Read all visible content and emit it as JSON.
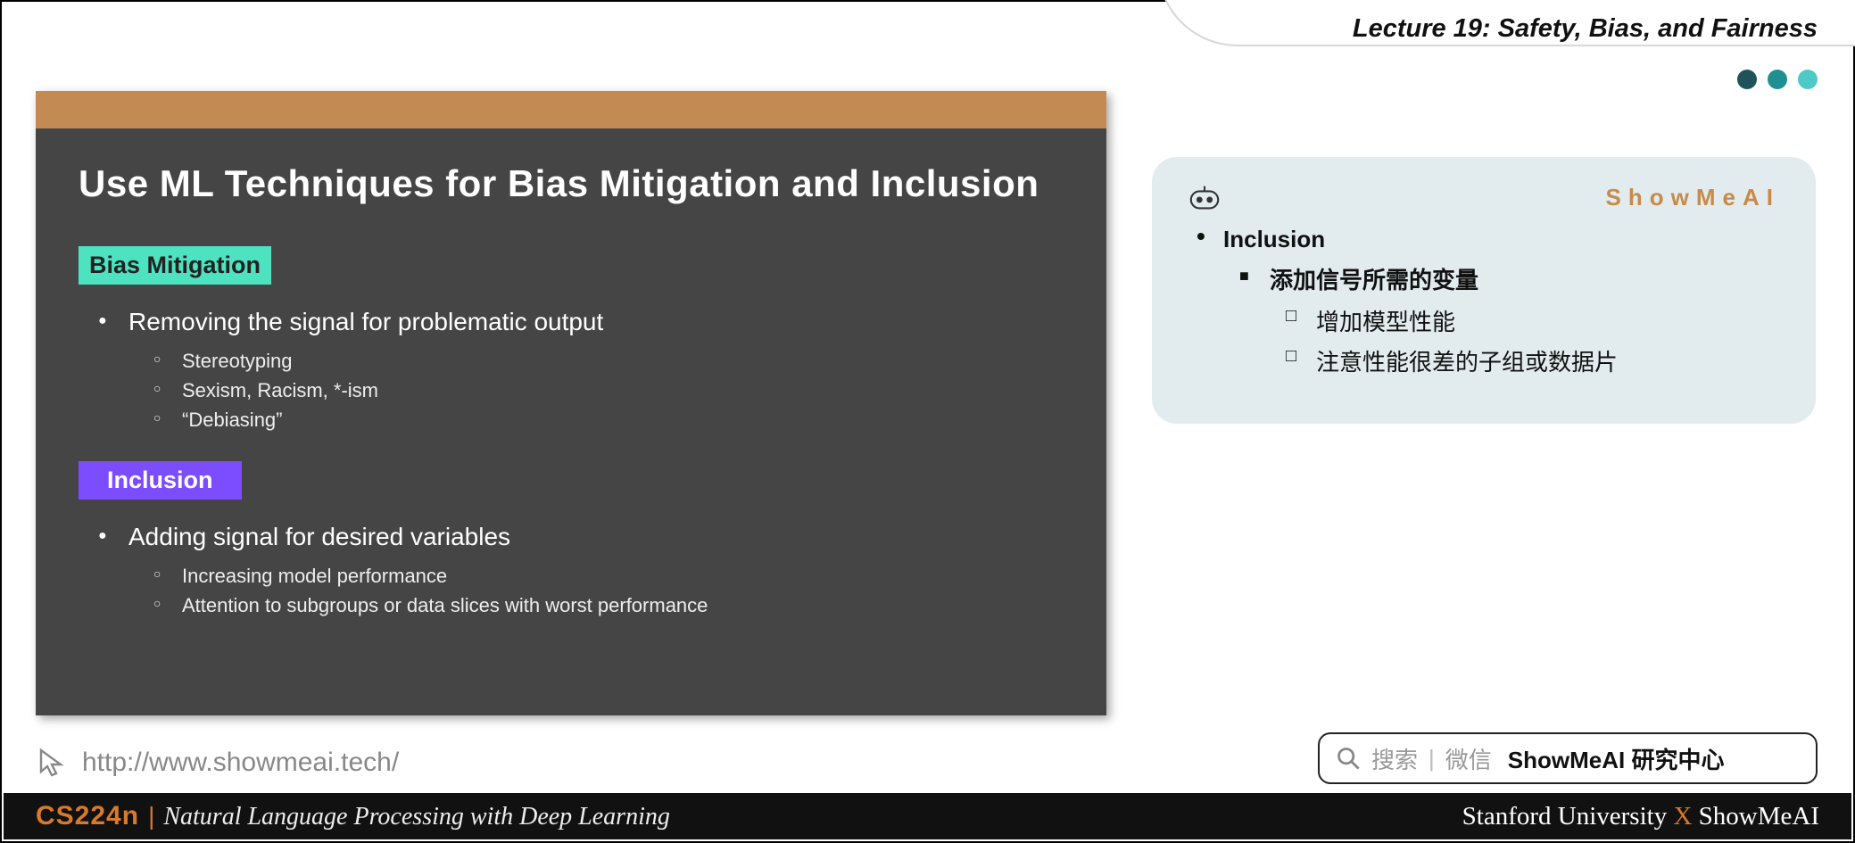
{
  "header": {
    "lecture_title": "Lecture 19: Safety, Bias, and Fairness"
  },
  "slide": {
    "title": "Use ML Techniques for Bias Mitigation and Inclusion",
    "section1": {
      "tag": "Bias Mitigation",
      "point": "Removing the signal for problematic output",
      "sub1": "Stereotyping",
      "sub2": "Sexism, Racism, *-ism",
      "sub3": "“Debiasing”"
    },
    "section2": {
      "tag": "Inclusion",
      "point": "Adding signal for desired variables",
      "sub1": "Increasing model performance",
      "sub2": "Attention to subgroups or data slices with worst performance"
    }
  },
  "notes": {
    "brand": "ShowMeAI",
    "lvl1": "Inclusion",
    "lvl2": "添加信号所需的变量",
    "lvl3a": "增加模型性能",
    "lvl3b": "注意性能很差的子组或数据片"
  },
  "url": "http://www.showmeai.tech/",
  "search": {
    "hint": "搜索",
    "wechat": "微信",
    "bold": "ShowMeAI 研究中心"
  },
  "footer": {
    "code": "CS224n",
    "pipe": "|",
    "course": "Natural Language Processing with Deep Learning",
    "uni": "Stanford University",
    "x": "X",
    "partner": "ShowMeAI"
  }
}
